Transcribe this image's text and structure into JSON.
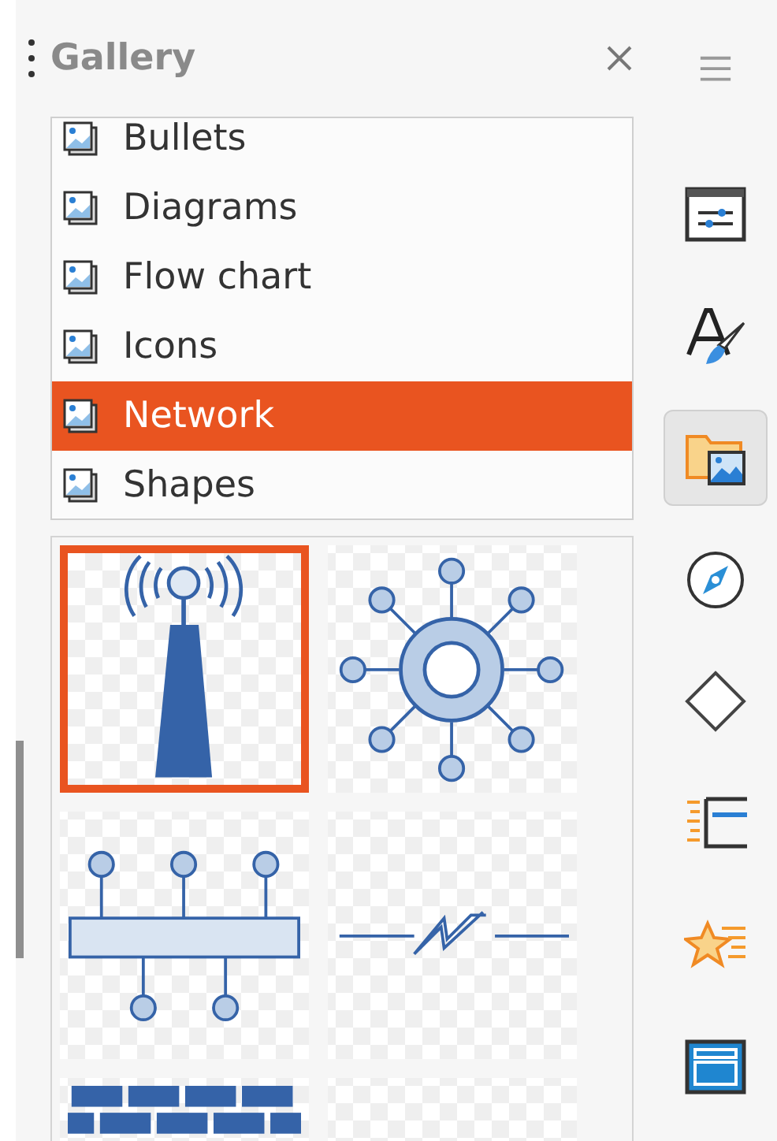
{
  "panel": {
    "title": "Gallery"
  },
  "themes": [
    {
      "label": "Bullets",
      "selected": false
    },
    {
      "label": "Diagrams",
      "selected": false
    },
    {
      "label": "Flow chart",
      "selected": false
    },
    {
      "label": "Icons",
      "selected": false
    },
    {
      "label": "Network",
      "selected": true
    },
    {
      "label": "Shapes",
      "selected": false
    }
  ],
  "thumbnails": [
    {
      "kind": "antenna",
      "selected": true
    },
    {
      "kind": "hub",
      "selected": false
    },
    {
      "kind": "bus",
      "selected": false
    },
    {
      "kind": "link",
      "selected": false
    },
    {
      "kind": "wall",
      "selected": false
    },
    {
      "kind": "blank",
      "selected": false
    }
  ],
  "sidebar_tabs": [
    {
      "kind": "properties",
      "selected": false
    },
    {
      "kind": "styles",
      "selected": false
    },
    {
      "kind": "gallery",
      "selected": true
    },
    {
      "kind": "navigator",
      "selected": false
    },
    {
      "kind": "shapes",
      "selected": false
    },
    {
      "kind": "animation",
      "selected": false
    },
    {
      "kind": "effects",
      "selected": false
    },
    {
      "kind": "layout",
      "selected": false
    }
  ]
}
